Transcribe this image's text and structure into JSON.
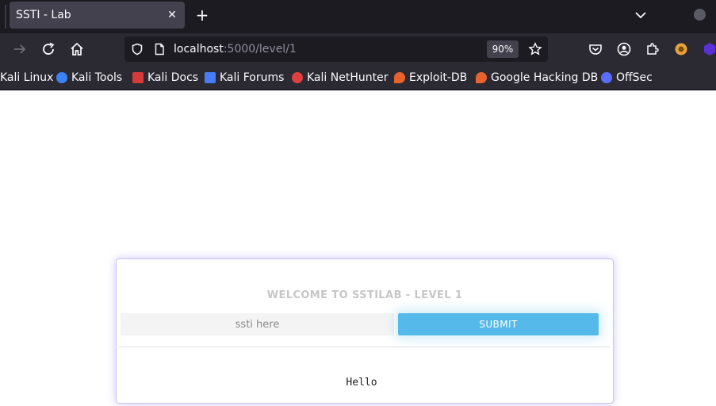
{
  "browser": {
    "tab": {
      "title": "SSTI - Lab",
      "close_icon": "close-icon"
    },
    "new_tab_icon": "plus-icon",
    "tab_list_icon": "chevron-down-icon",
    "url": {
      "host": "localhost",
      "path": ":5000/level/1"
    },
    "zoom": "90%",
    "bookmarks": [
      {
        "label": "Kali Linux",
        "icon": "kali-icon",
        "color": "#367bf0"
      },
      {
        "label": "Kali Tools",
        "icon": "kali-tools-icon",
        "color": "#3b82f6"
      },
      {
        "label": "Kali Docs",
        "icon": "kali-docs-icon",
        "color": "#d63a3a"
      },
      {
        "label": "Kali Forums",
        "icon": "kali-forums-icon",
        "color": "#4a7cf7"
      },
      {
        "label": "Kali NetHunter",
        "icon": "nethunter-icon",
        "color": "#e04040"
      },
      {
        "label": "Exploit-DB",
        "icon": "exploit-db-icon",
        "color": "#e8622c"
      },
      {
        "label": "Google Hacking DB",
        "icon": "ghdb-icon",
        "color": "#e8622c"
      },
      {
        "label": "OffSec",
        "icon": "offsec-icon",
        "color": "#5b6cff"
      }
    ]
  },
  "page": {
    "heading": "WELCOME TO SSTILAB - LEVEL 1",
    "input_placeholder": "ssti here",
    "submit_label": "SUBMIT",
    "result": "Hello"
  },
  "colors": {
    "accent": "#55b9ea",
    "card_glow": "#8c78eb",
    "heading": "#c6c6c6"
  }
}
